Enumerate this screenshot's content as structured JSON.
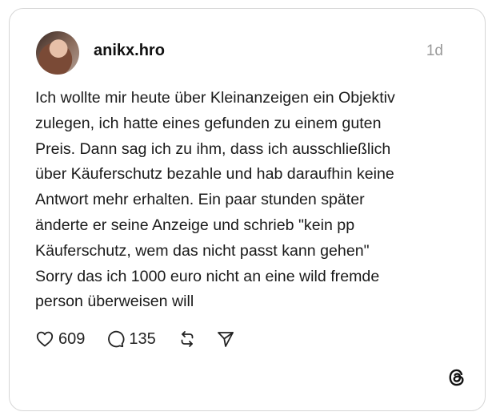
{
  "post": {
    "username": "anikx.hro",
    "time": "1d",
    "text_lines": [
      "Ich wollte mir heute über Kleinanzeigen ein Objektiv",
      "zulegen, ich hatte eines gefunden zu einem guten",
      "Preis. Dann sag ich zu ihm, dass ich ausschließlich",
      "über Käuferschutz bezahle und hab daraufhin keine",
      "Antwort mehr erhalten. Ein paar stunden später",
      "änderte er seine Anzeige und schrieb \"kein pp",
      "Käuferschutz, wem das nicht passt kann gehen\"",
      "Sorry das ich 1000 euro nicht an eine wild fremde",
      "person überweisen will"
    ],
    "likes": "609",
    "replies": "135"
  },
  "icons": {
    "like": "heart-icon",
    "reply": "speech-bubble-icon",
    "repost": "repost-icon",
    "share": "send-icon",
    "brand": "threads-logo"
  },
  "colors": {
    "text": "#1a1a1a",
    "secondary": "#9a9a9a",
    "border": "#d6d6d6"
  }
}
